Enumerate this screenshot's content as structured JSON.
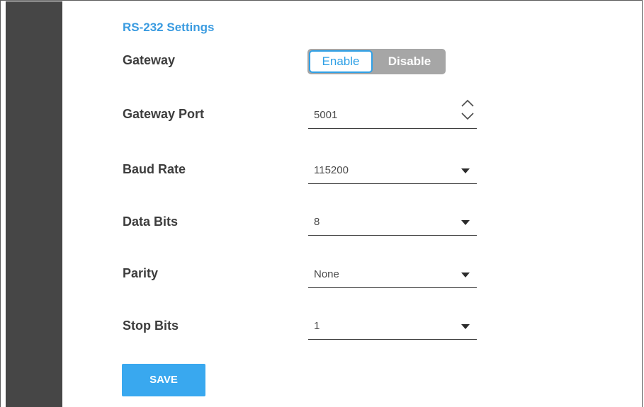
{
  "section": {
    "title": "RS-232 Settings"
  },
  "gateway": {
    "label": "Gateway",
    "enable_label": "Enable",
    "disable_label": "Disable",
    "selected": "Enable"
  },
  "gateway_port": {
    "label": "Gateway Port",
    "value": "5001",
    "control": "number-stepper"
  },
  "baud_rate": {
    "label": "Baud Rate",
    "value": "115200"
  },
  "data_bits": {
    "label": "Data Bits",
    "value": "8"
  },
  "parity": {
    "label": "Parity",
    "value": "None"
  },
  "stop_bits": {
    "label": "Stop Bits",
    "value": "1"
  },
  "save_button": {
    "label": "SAVE"
  },
  "colors": {
    "accent": "#39a8ef",
    "sidebar": "#464646",
    "toggle_off": "#a6a6a6",
    "text": "#3d3d3d"
  },
  "icons": {
    "stepper_up": "chevron-up-icon",
    "stepper_down": "chevron-down-icon",
    "dropdown": "caret-down-icon"
  }
}
